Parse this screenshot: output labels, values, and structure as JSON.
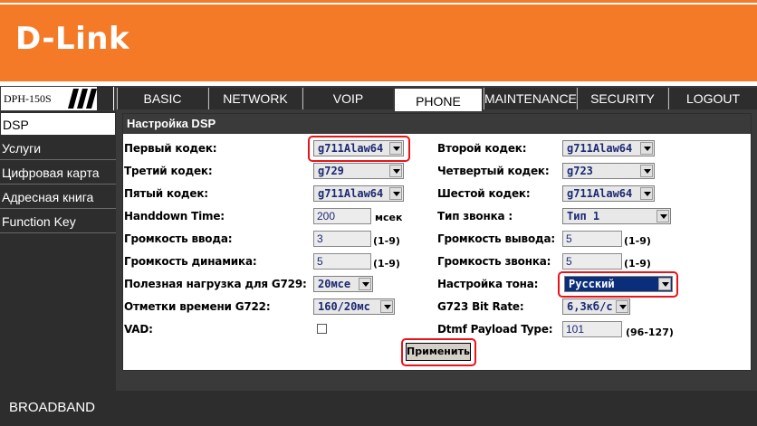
{
  "brand": {
    "logo_text": "D-Link"
  },
  "model": "DPH-150S",
  "nav": {
    "tabs": [
      "BASIC",
      "NETWORK",
      "VOIP",
      "PHONE",
      "MAINTENANCE",
      "SECURITY",
      "LOGOUT"
    ],
    "active": "PHONE"
  },
  "sidebar": {
    "items": [
      "DSP",
      "Услуги",
      "Цифровая карта",
      "Адресная книга",
      "Function Key"
    ],
    "active": "DSP"
  },
  "panel": {
    "title": "Настройка DSP",
    "codec1": {
      "label": "Первый кодек:",
      "value": "g711Alaw64"
    },
    "codec2": {
      "label": "Второй кодек:",
      "value": "g711Alaw64"
    },
    "codec3": {
      "label": "Третий кодек:",
      "value": "g729"
    },
    "codec4": {
      "label": "Четвертый кодек:",
      "value": "g723"
    },
    "codec5": {
      "label": "Пятый кодек:",
      "value": "g711Alaw64"
    },
    "codec6": {
      "label": "Шестой кодек:",
      "value": "g711Alaw64"
    },
    "handdown": {
      "label": "Handdown Time:",
      "value": "200",
      "unit": "мсек"
    },
    "ring_type": {
      "label": "Тип звонка :",
      "value": "Тип 1"
    },
    "input_volume": {
      "label": "Громкость ввода:",
      "value": "3",
      "range": "(1-9)"
    },
    "output_volume": {
      "label": "Громкость вывода:",
      "value": "5",
      "range": "(1-9)"
    },
    "speaker_volume": {
      "label": "Громкость динамика:",
      "value": "5",
      "range": "(1-9)"
    },
    "ring_volume": {
      "label": "Громкость звонка:",
      "value": "5",
      "range": "(1-9)"
    },
    "g729_payload": {
      "label": "Полезная нагрузка для G729:",
      "value": "20мсе"
    },
    "tone": {
      "label": "Настройка тона:",
      "value": "Русский"
    },
    "g722_timestamps": {
      "label": "Отметки времени G722:",
      "value": "160/20мс"
    },
    "g723_rate": {
      "label": "G723 Bit Rate:",
      "value": "6,3кб/с"
    },
    "vad": {
      "label": "VAD:",
      "checked": false
    },
    "dtmf": {
      "label": "Dtmf Payload Type:",
      "value": "101",
      "range": "(96-127)"
    },
    "apply_label": "Применить"
  },
  "footer": {
    "text": "BROADBAND"
  },
  "colors": {
    "brand_orange": "#f47a28",
    "dark_bar": "#2d2d2d",
    "highlight_red": "#e8141a",
    "select_text": "#1c2a72"
  }
}
